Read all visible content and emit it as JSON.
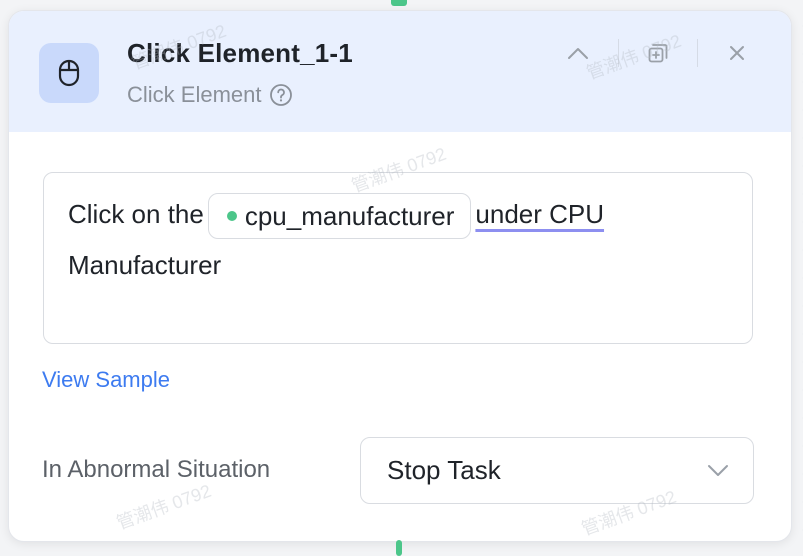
{
  "node": {
    "title": "Click Element_1-1",
    "type_label": "Click Element",
    "icon": "mouse-icon"
  },
  "header_actions": {
    "collapse_icon": "chevron-up-icon",
    "copy_icon": "duplicate-icon",
    "close_icon": "close-icon"
  },
  "instruction": {
    "prefix": "Click on the",
    "parameter": "cpu_manufacturer",
    "linked_text": "under CPU",
    "suffix": "Manufacturer"
  },
  "view_sample_label": "View Sample",
  "abnormal": {
    "label": "In Abnormal Situation",
    "selected": "Stop Task"
  },
  "watermark_text": "管潮伟 0792",
  "colors": {
    "header_bg": "#e9f0fe",
    "icon_bg": "#c9d9fb",
    "accent_link": "#3d7bf0",
    "param_dot": "#4cc68a",
    "underline": "#8d8ff0"
  }
}
